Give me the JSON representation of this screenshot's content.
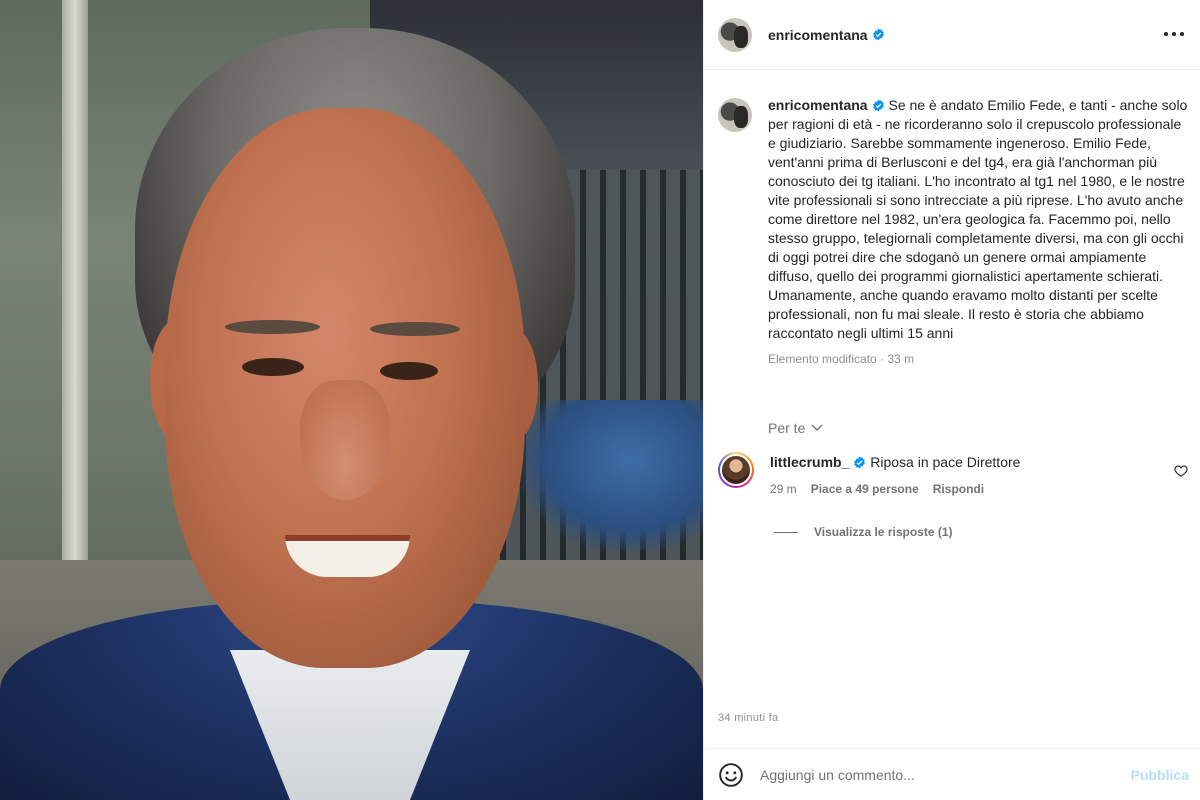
{
  "post": {
    "author": "enricomentana",
    "caption": "Se ne è andato Emilio Fede, e tanti - anche solo per ragioni di età - ne ricorderanno solo il crepuscolo professionale e giudiziario. Sarebbe sommamente ingeneroso. Emilio Fede, vent'anni prima di Berlusconi e del tg4, era già l'anchorman più conosciuto dei tg italiani. L'ho incontrato al tg1 nel 1980, e le nostre vite professionali si sono intrecciate a più riprese. L'ho avuto anche come direttore nel 1982, un'era geologica fa. Facemmo poi, nello stesso gruppo, telegiornali completamente diversi, ma con gli occhi di oggi potrei dire che sdoganò un genere ormai ampiamente diffuso, quello dei programmi giornalistici apertamente schierati. Umanamente, anche quando eravamo molto distanti per scelte professionali, non fu mai sleale. Il resto è storia che abbiamo raccontato negli ultimi 15 anni",
    "caption_meta": "Elemento modificato · 33 m",
    "timestamp": "34 minuti fa"
  },
  "for_you_label": "Per te",
  "comments": [
    {
      "author": "littlecrumb_",
      "text": "Riposa in pace Direttore",
      "time": "29 m",
      "likes": "Piace a 49 persone",
      "reply_label": "Rispondi",
      "view_replies": "Visualizza le risposte (1)"
    }
  ],
  "composer": {
    "placeholder": "Aggiungi un commento...",
    "publish_label": "Pubblica"
  },
  "colors": {
    "verified": "#0095f6",
    "publish_disabled": "#b2dffc",
    "secondary_text": "#737373"
  },
  "icons": [
    "verified-badge-icon",
    "more-options-icon",
    "chevron-down-icon",
    "heart-icon",
    "emoji-icon"
  ]
}
